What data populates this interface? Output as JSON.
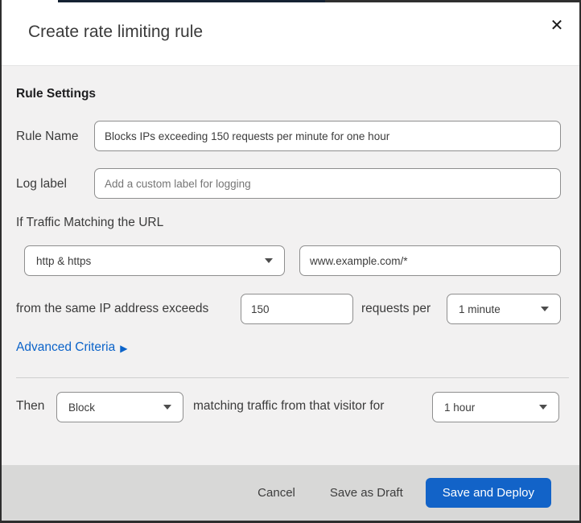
{
  "colors": {
    "accent_blue": "#1263c8",
    "link_blue": "#0b63c9",
    "body_bg": "#f2f1f1",
    "footer_bg": "#d8d8d7",
    "frame_border": "#2e2e2e"
  },
  "icons": {
    "close": "✕",
    "caret_right": "▶",
    "caret_down": "▼"
  },
  "modal": {
    "title": "Create rate limiting rule"
  },
  "rule_settings": {
    "heading": "Rule Settings",
    "rule_name": {
      "label": "Rule Name",
      "value": "Blocks IPs exceeding 150 requests per minute for one hour"
    },
    "log_label": {
      "label": "Log label",
      "placeholder": "Add a custom label for logging"
    }
  },
  "traffic_match": {
    "intro": "If Traffic Matching the URL",
    "scheme": "http & https",
    "url_pattern": "www.example.com/*",
    "threshold_prefix": "from the same IP address exceeds",
    "threshold": "150",
    "threshold_suffix": "requests per",
    "period": "1 minute",
    "advanced_link": "Advanced Criteria"
  },
  "action": {
    "then_label": "Then",
    "action": "Block",
    "middle_text": "matching traffic from that visitor for",
    "duration": "1 hour"
  },
  "footer": {
    "cancel": "Cancel",
    "save_draft": "Save as Draft",
    "save_deploy": "Save and Deploy"
  }
}
